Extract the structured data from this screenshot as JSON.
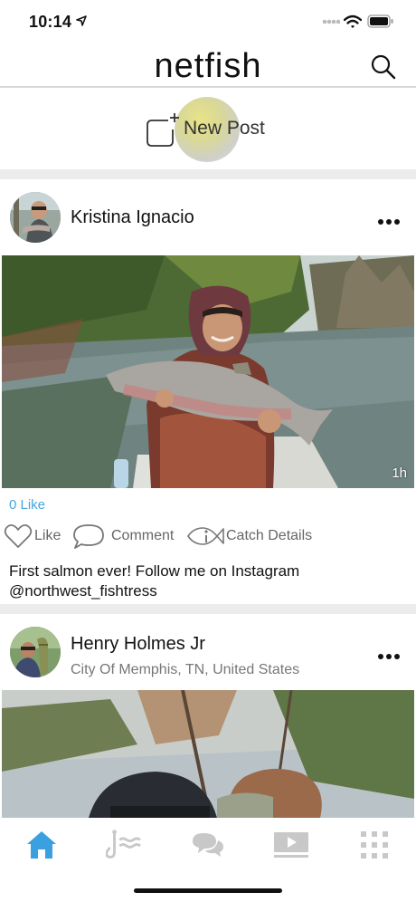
{
  "status_bar": {
    "time": "10:14"
  },
  "header": {
    "title": "netfish"
  },
  "new_post": {
    "label": "New Post"
  },
  "posts": [
    {
      "author": "Kristina Ignacio",
      "time_ago": "1h",
      "likes": "0 Like",
      "actions": {
        "like": "Like",
        "comment": "Comment",
        "catch_details": "Catch Details"
      },
      "caption": "First salmon ever! Follow me on Instagram @northwest_fishtress"
    },
    {
      "author": "Henry Holmes Jr",
      "location": "City Of Memphis, TN, United States"
    }
  ],
  "tab_bar": {
    "active_color": "#3aa0e0",
    "inactive_color": "#c8c8c8",
    "tabs": [
      "home-icon",
      "fishing-hook-icon",
      "chat-icon",
      "video-icon",
      "grid-icon"
    ]
  }
}
